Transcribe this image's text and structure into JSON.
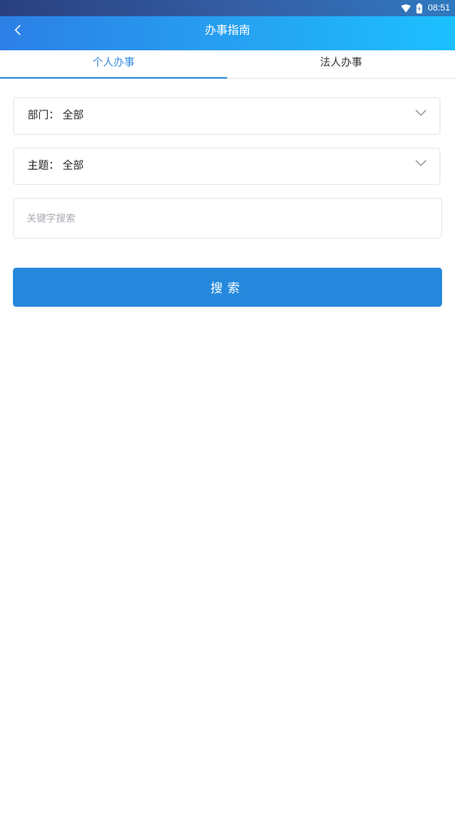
{
  "status_bar": {
    "time": "08:51",
    "icons": [
      "wifi-icon",
      "battery-icon"
    ]
  },
  "header": {
    "title": "办事指南",
    "back_icon": "chevron-left-icon"
  },
  "tabs": [
    {
      "label": "个人办事",
      "active": true
    },
    {
      "label": "法人办事",
      "active": false
    }
  ],
  "form": {
    "department": {
      "label": "部门",
      "value": "全部",
      "text": "部门： 全部"
    },
    "topic": {
      "label": "主题",
      "value": "全部",
      "text": "主题： 全部"
    },
    "search": {
      "value": "",
      "placeholder": "关键字搜索"
    },
    "search_button_label": "搜索"
  },
  "colors": {
    "header_gradient_start": "#2c7fe6",
    "header_gradient_end": "#1cc0ff",
    "accent": "#3a8ee0",
    "button": "#2588dc"
  }
}
